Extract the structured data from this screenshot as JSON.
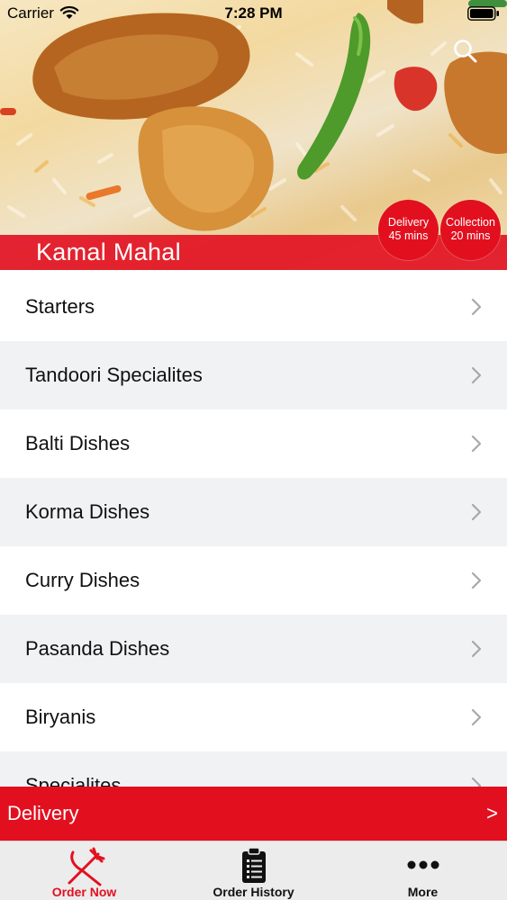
{
  "status_bar": {
    "carrier": "Carrier",
    "time": "7:28 PM"
  },
  "restaurant": {
    "name": "Kamal Mahal"
  },
  "badges": {
    "delivery": {
      "label": "Delivery",
      "time": "45 mins"
    },
    "collection": {
      "label": "Collection",
      "time": "20 mins"
    }
  },
  "menu": {
    "categories": [
      {
        "label": "Starters"
      },
      {
        "label": "Tandoori Specialites"
      },
      {
        "label": "Balti Dishes"
      },
      {
        "label": "Korma Dishes"
      },
      {
        "label": "Curry Dishes"
      },
      {
        "label": "Pasanda Dishes"
      },
      {
        "label": "Biryanis"
      },
      {
        "label": "Specialites"
      }
    ]
  },
  "delivery_bar": {
    "label": "Delivery",
    "arrow": ">"
  },
  "tabs": [
    {
      "label": "Order Now",
      "icon": "fork-knife-icon",
      "active": true
    },
    {
      "label": "Order History",
      "icon": "clipboard-icon",
      "active": false
    },
    {
      "label": "More",
      "icon": "more-dots-icon",
      "active": false
    }
  ],
  "colors": {
    "accent": "#e2101f",
    "row_alt": "#f1f2f4",
    "tab_bar": "#ececec"
  },
  "icons": {
    "search": "search-icon",
    "chevron": "chevron-right-icon",
    "wifi": "wifi-icon",
    "battery": "battery-icon"
  }
}
